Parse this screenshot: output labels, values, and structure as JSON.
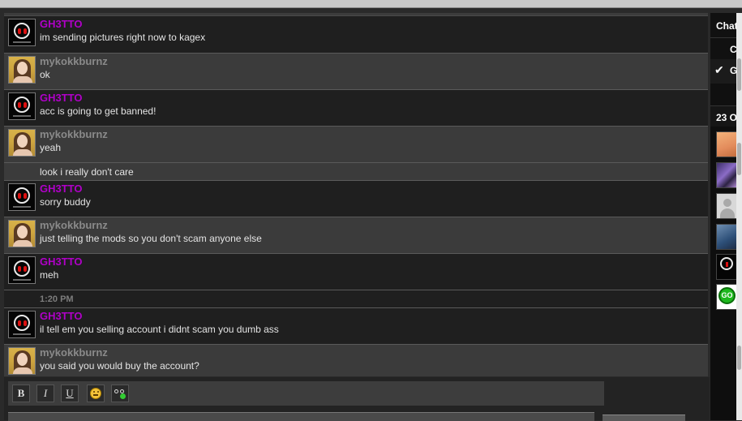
{
  "sidebar": {
    "header_title": "Chat",
    "row1_label": "Ch",
    "row2_label": "G",
    "row2_icon": "checkmark-icon",
    "count_label": "23 O",
    "user_avatars": [
      "anime-girl-avatar",
      "purple-art-avatar",
      "default-silhouette-avatar",
      "blue-photo-avatar",
      "ghetto-mask-avatar",
      "go-button-avatar"
    ]
  },
  "chat": {
    "messages": [
      {
        "user": "GH3TTO",
        "text": "im sending pictures right now to kagex"
      },
      {
        "user": "mykokkburnz",
        "text": "ok"
      },
      {
        "user": "GH3TTO",
        "text": "acc is going to get banned!"
      },
      {
        "user": "mykokkburnz",
        "text": "yeah",
        "continuation": "look i really don't care"
      },
      {
        "user": "GH3TTO",
        "text": "sorry buddy"
      },
      {
        "user": "mykokkburnz",
        "text": "just telling the mods so you don't scam anyone else"
      },
      {
        "user": "GH3TTO",
        "text": "meh"
      },
      {
        "timestamp": "1:20 PM"
      },
      {
        "user": "GH3TTO",
        "text": "il tell em you selling account i didnt scam you dumb ass"
      },
      {
        "user": "mykokkburnz",
        "text": "you said you would buy the account?"
      }
    ]
  },
  "toolbar": {
    "bold": "B",
    "italic": "I",
    "underline": "U",
    "emoji_icon": "smiley-icon",
    "hide_icon": "glasses-icon"
  },
  "colors": {
    "ghetto_name": "#b000c8",
    "mykokk_name": "#8a8a8a",
    "message_text": "#e4e4e4",
    "panel_dark": "#1f1f1f",
    "panel_light": "#3b3b3b"
  }
}
